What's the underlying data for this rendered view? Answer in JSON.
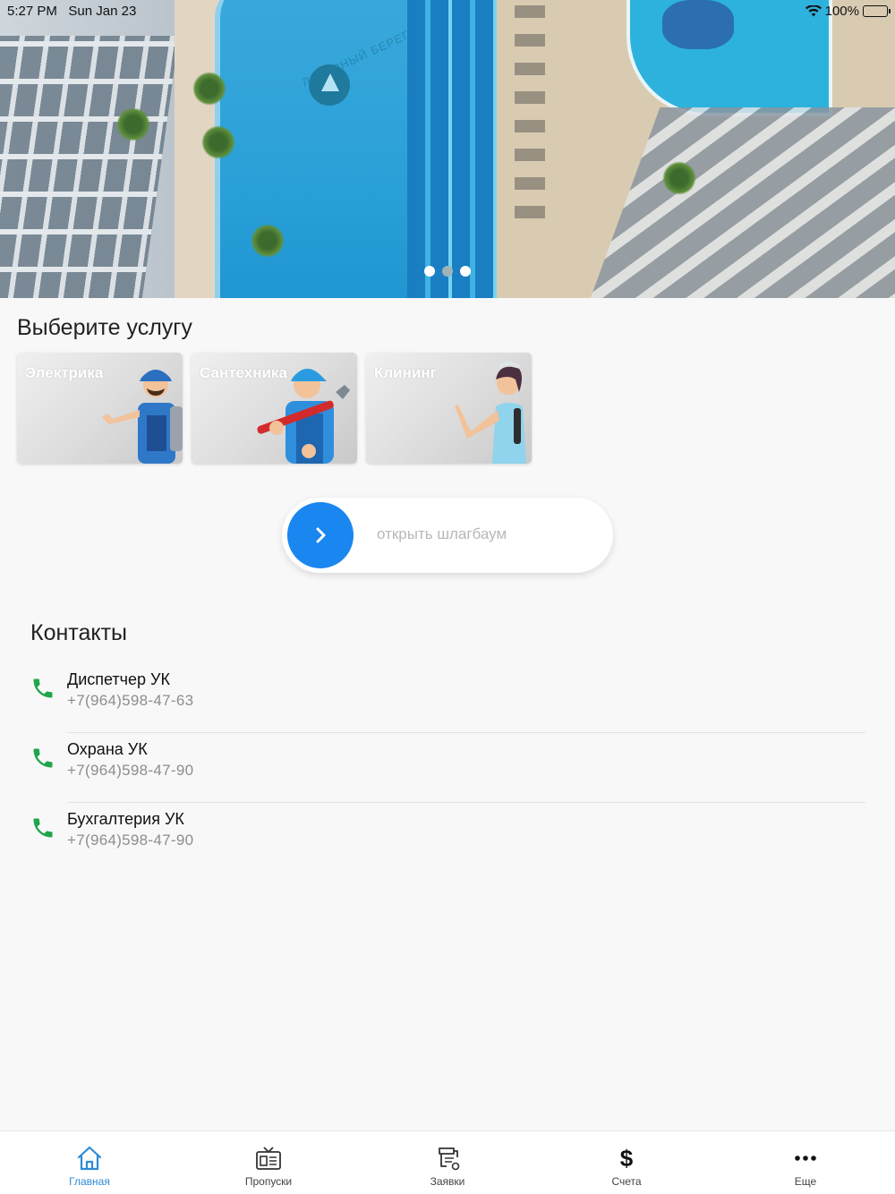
{
  "status_bar": {
    "time": "5:27 PM",
    "date": "Sun Jan 23",
    "battery": "100%"
  },
  "hero": {
    "pool_sign": "ЛАЗУРНЫЙ БЕРЕГ",
    "slides_count": 3,
    "active_slide": 1
  },
  "services": {
    "title": "Выберите услугу",
    "items": [
      {
        "label": "Электрика",
        "icon": "electrician-illustration"
      },
      {
        "label": "Сантехника",
        "icon": "plumber-illustration"
      },
      {
        "label": "Клининг",
        "icon": "cleaner-illustration"
      }
    ]
  },
  "barrier": {
    "label": "открыть шлагбаум",
    "knob_icon": "chevron-right-icon",
    "knob_color": "#1a86f0"
  },
  "contacts": {
    "title": "Контакты",
    "items": [
      {
        "name": "Диспетчер УК",
        "phone": "+7(964)598-47-63"
      },
      {
        "name": "Охрана УК",
        "phone": "+7(964)598-47-90"
      },
      {
        "name": "Бухгалтерия УК",
        "phone": "+7(964)598-47-90"
      }
    ],
    "phone_icon_color": "#1fa64a"
  },
  "tabbar": {
    "items": [
      {
        "label": "Главная",
        "icon": "home-icon",
        "active": true
      },
      {
        "label": "Пропуски",
        "icon": "tv-pass-icon",
        "active": false
      },
      {
        "label": "Заявки",
        "icon": "faucet-request-icon",
        "active": false
      },
      {
        "label": "Счета",
        "icon": "dollar-icon",
        "active": false
      },
      {
        "label": "Еще",
        "icon": "more-dots-icon",
        "active": false
      }
    ],
    "active_color": "#2d8bd6"
  }
}
